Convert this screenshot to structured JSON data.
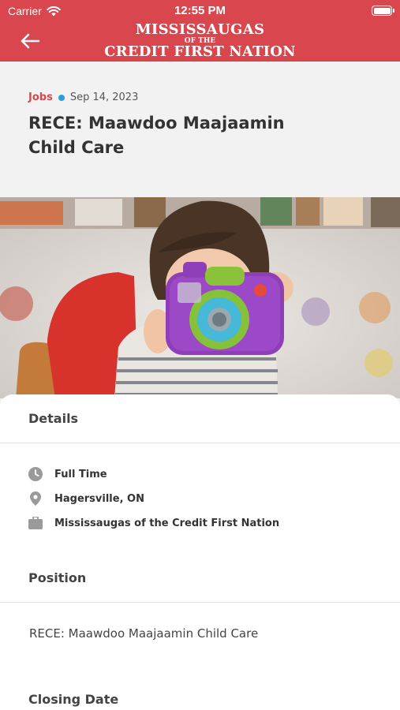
{
  "status_bar": {
    "carrier": "Carrier",
    "time": "12:55 PM"
  },
  "header": {
    "logo_line1": "MISSISSAUGAS",
    "logo_line2": "OF THE",
    "logo_line3": "CREDIT FIRST NATION"
  },
  "article": {
    "category": "Jobs",
    "date": "Sep 14, 2023",
    "title": "RECE: Maawdoo Maajaamin Child Care"
  },
  "details": {
    "heading": "Details",
    "employment_type": "Full Time",
    "location": "Hagersville, ON",
    "employer": "Mississaugas of the Credit First Nation"
  },
  "position": {
    "heading": "Position",
    "text": "RECE: Maawdoo Maajaamin Child Care"
  },
  "closing": {
    "heading": "Closing Date"
  },
  "colors": {
    "brand_red": "#d9464e",
    "dot_blue": "#2d9cdb",
    "icon_grey": "#9a9a9a"
  }
}
